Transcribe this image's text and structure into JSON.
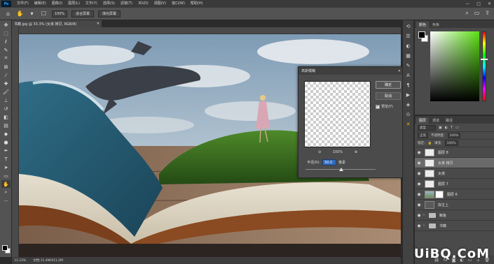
{
  "app": {
    "logo": "Ps"
  },
  "menu": [
    "文件(F)",
    "编辑(E)",
    "图像(I)",
    "图层(L)",
    "文字(Y)",
    "选择(S)",
    "滤镜(T)",
    "3D(D)",
    "视图(V)",
    "窗口(W)",
    "帮助(H)"
  ],
  "window_controls": [
    "—",
    "□",
    "✕"
  ],
  "options": {
    "zoom": "100%",
    "fit_screen": "适合屏幕",
    "fill_screen": "填充屏幕"
  },
  "document": {
    "tab_title": "书籍.jpg @ 33.3% (女孩 拷贝, RGB/8)",
    "tab_close": "✕"
  },
  "status": {
    "zoom": "33.33%",
    "doc_size": "文档:11.4M/411.2M"
  },
  "dialog": {
    "title": "高斯模糊",
    "close": "✕",
    "ok_label": "确定",
    "cancel_label": "取消",
    "preview_label": "预览(P)",
    "preview_checked": true,
    "zoom_out": "⊖",
    "zoom_in": "⊕",
    "zoom_level": "100%",
    "radius_label": "半径(R):",
    "radius_value": "50.0",
    "radius_unit": "像素"
  },
  "color_panel": {
    "tabs": [
      "颜色",
      "色板"
    ],
    "hue_colors": [
      "#5be014"
    ]
  },
  "layers_panel": {
    "tabs": [
      "图层",
      "通道",
      "路径"
    ],
    "kind_label": "类型",
    "blend_mode": "正常",
    "opacity_label": "不透明度:",
    "opacity_value": "100%",
    "lock_label": "锁定:",
    "fill_label": "填充:",
    "fill_value": "100%",
    "layers": [
      {
        "name": "图层 8",
        "thumb": "light",
        "selected": false
      },
      {
        "name": "女孩 拷贝",
        "thumb": "light",
        "selected": true
      },
      {
        "name": "女孩",
        "thumb": "light",
        "selected": false
      },
      {
        "name": "图层 7",
        "thumb": "light",
        "selected": false
      },
      {
        "name": "图层 6",
        "thumb": "scene",
        "selected": false
      },
      {
        "name": "拟主上",
        "thumb": "dark",
        "selected": false
      },
      {
        "name": "鲸鱼",
        "thumb": "folder",
        "selected": false
      },
      {
        "name": "书籍",
        "thumb": "folder",
        "selected": false
      }
    ]
  },
  "watermark": "UiBQ.CoM"
}
